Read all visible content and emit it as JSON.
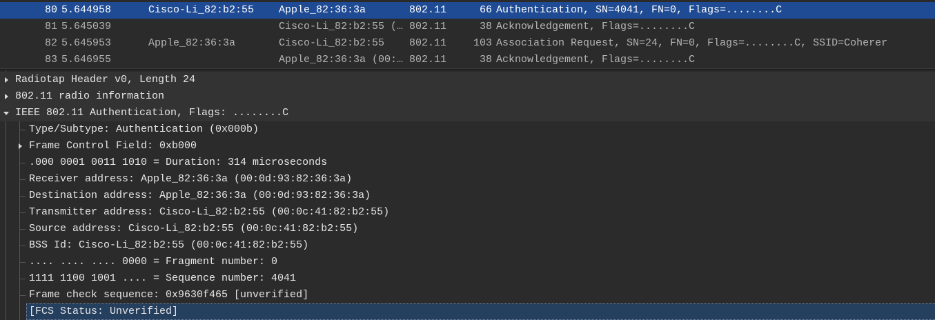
{
  "packets": [
    {
      "no": "80",
      "time": "5.644958",
      "source": "Cisco-Li_82:b2:55",
      "destination": "Apple_82:36:3a",
      "protocol": "802.11",
      "length": "66",
      "info": "Authentication, SN=4041, FN=0, Flags=........C"
    },
    {
      "no": "81",
      "time": "5.645039",
      "source": "",
      "destination": "Cisco-Li_82:b2:55 (…",
      "protocol": "802.11",
      "length": "38",
      "info": "Acknowledgement, Flags=........C"
    },
    {
      "no": "82",
      "time": "5.645953",
      "source": "Apple_82:36:3a",
      "destination": "Cisco-Li_82:b2:55",
      "protocol": "802.11",
      "length": "103",
      "info": "Association Request, SN=24, FN=0, Flags=........C, SSID=Coherer"
    },
    {
      "no": "83",
      "time": "5.646955",
      "source": "",
      "destination": "Apple_82:36:3a (00:…",
      "protocol": "802.11",
      "length": "38",
      "info": "Acknowledgement, Flags=........C"
    }
  ],
  "details": {
    "radiotap": "Radiotap Header v0, Length 24",
    "radio_info": "802.11 radio information",
    "ieee": "IEEE 802.11 Authentication, Flags: ........C",
    "fields": [
      "Type/Subtype: Authentication (0x000b)",
      "Frame Control Field: 0xb000",
      ".000 0001 0011 1010 = Duration: 314 microseconds",
      "Receiver address: Apple_82:36:3a (00:0d:93:82:36:3a)",
      "Destination address: Apple_82:36:3a (00:0d:93:82:36:3a)",
      "Transmitter address: Cisco-Li_82:b2:55 (00:0c:41:82:b2:55)",
      "Source address: Cisco-Li_82:b2:55 (00:0c:41:82:b2:55)",
      "BSS Id: Cisco-Li_82:b2:55 (00:0c:41:82:b2:55)",
      ".... .... .... 0000 = Fragment number: 0",
      "1111 1100 1001 .... = Sequence number: 4041",
      "Frame check sequence: 0x9630f465 [unverified]",
      "[FCS Status: Unverified]"
    ]
  },
  "colors": {
    "selected_row": "#1f4b94",
    "selected_detail": "#253f5f",
    "background": "#2b2b2b"
  }
}
